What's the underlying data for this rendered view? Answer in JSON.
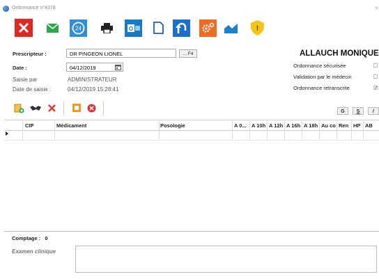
{
  "window": {
    "title": "Ordonnance n°4378",
    "close": "×"
  },
  "toolbar": {
    "icons": [
      "close-x-icon",
      "envelope-icon",
      "clock-24-icon",
      "printer-icon",
      "outlook-icon",
      "document-icon",
      "undo-arrow-icon",
      "settings-gear-icon",
      "chart-icon",
      "shield-alert-icon"
    ],
    "clock_label": "24",
    "outlook_label": "O",
    "shield_label": "!"
  },
  "form": {
    "prescripteur_label": "Prescripteur :",
    "prescripteur_value": "DR PINGEON LIONEL",
    "f4_button": "... F4",
    "date_label": "Date :",
    "date_value": "04/12/2019",
    "saisie_par_label": "Saisie par",
    "saisie_par_value": "ADMINISTRATEUR",
    "date_saisie_label": "Date de saisie :",
    "date_saisie_value": "04/12/2019 15:28:41"
  },
  "patient": {
    "name": "ALLAUCH MONIQUE",
    "flags": [
      {
        "label": "Ordonnance sécurisée",
        "checked": false
      },
      {
        "label": "Validation par le médecin",
        "checked": false
      },
      {
        "label": "Ordonnance retranscrite",
        "checked": true
      }
    ]
  },
  "subtoolbar": {
    "icons": [
      "add-line-icon",
      "glasses-icon",
      "delete-icon",
      "orange-note-icon",
      "red-cancel-icon"
    ],
    "mini_buttons": [
      "G",
      "S",
      "/"
    ]
  },
  "grid": {
    "columns": [
      "CIP",
      "Médicament",
      "Posologie",
      "A 0...",
      "A 10h",
      "A 12h",
      "A 16h",
      "A 18h",
      "Au co",
      "Ren",
      "HP",
      "AB"
    ]
  },
  "footer": {
    "comptage_label": "Comptage :",
    "comptage_value": "0",
    "examen_label": "Examen clinique"
  }
}
